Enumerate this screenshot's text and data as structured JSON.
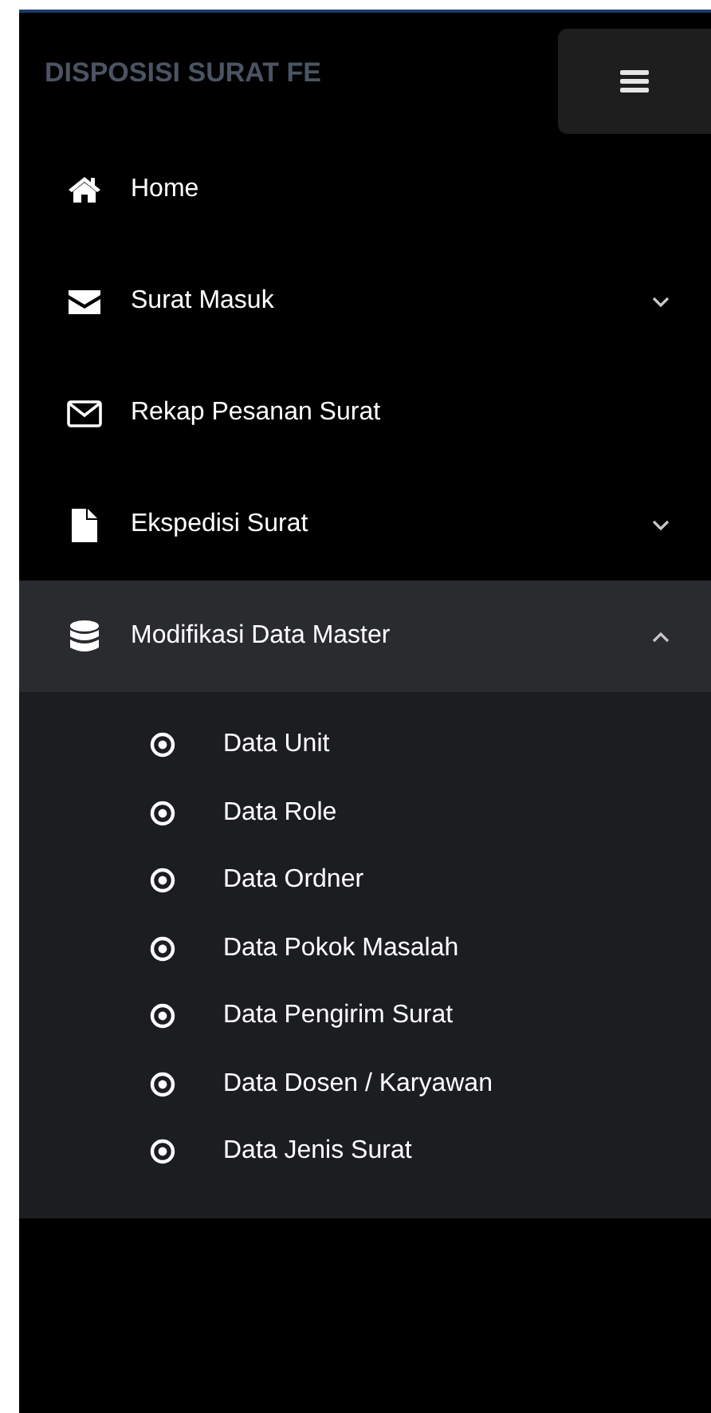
{
  "brand": "DISPOSISI SURAT FE",
  "menu": [
    {
      "label": "Home",
      "kind": "link"
    },
    {
      "label": "Surat Masuk",
      "kind": "group",
      "expanded": false
    },
    {
      "label": "Rekap Pesanan Surat",
      "kind": "link"
    },
    {
      "label": "Ekspedisi Surat",
      "kind": "group",
      "expanded": false
    },
    {
      "label": "Modifikasi Data Master",
      "kind": "group",
      "expanded": true,
      "children": [
        {
          "label": "Data Unit"
        },
        {
          "label": "Data Role"
        },
        {
          "label": "Data Ordner"
        },
        {
          "label": "Data Pokok Masalah"
        },
        {
          "label": "Data Pengirim Surat"
        },
        {
          "label": "Data Dosen / Karyawan"
        },
        {
          "label": "Data Jenis Surat"
        }
      ]
    }
  ]
}
